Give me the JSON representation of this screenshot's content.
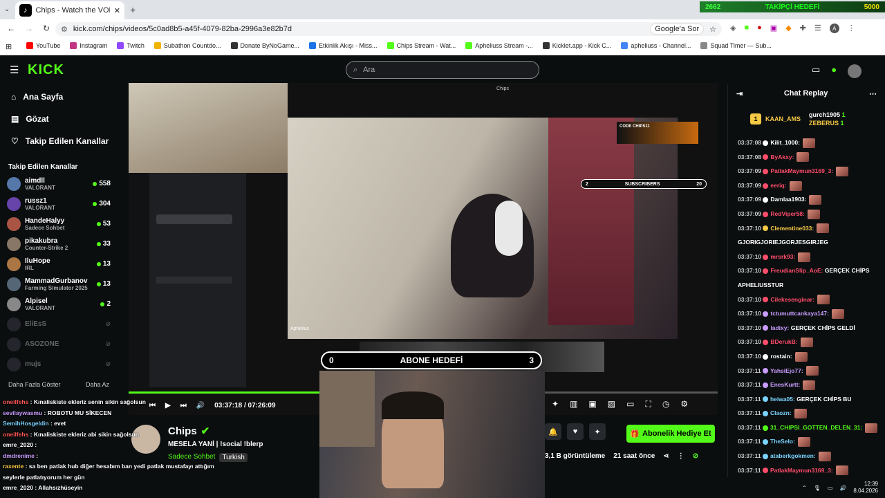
{
  "browser": {
    "tab_title": "Chips - Watch the VOD on Kick",
    "url": "kick.com/chips/videos/5c0ad8b5-a45f-4079-82ba-2996a3e82b7d",
    "google_btn": "Google'a Sor"
  },
  "goal_overlay": {
    "left": "2662",
    "mid": "TAKİPÇİ HEDEFİ",
    "right": "5000"
  },
  "bookmarks": [
    {
      "label": "YouTube",
      "color": "#ff0000"
    },
    {
      "label": "Instagram",
      "color": "#c13584"
    },
    {
      "label": "Twitch",
      "color": "#9146ff"
    },
    {
      "label": "Subathon Countdo...",
      "color": "#f0b400"
    },
    {
      "label": "Donate ByNoGame...",
      "color": "#333"
    },
    {
      "label": "Etkinlik Akışı - Miss...",
      "color": "#1a73e8"
    },
    {
      "label": "Chips Stream - Wat...",
      "color": "#53fc18"
    },
    {
      "label": "Apheliuss Stream -...",
      "color": "#53fc18"
    },
    {
      "label": "Kicklet.app - Kick C...",
      "color": "#333"
    },
    {
      "label": "apheliuss - Channel...",
      "color": "#4285f4"
    },
    {
      "label": "Squad Timer — Sub...",
      "color": "#888"
    }
  ],
  "kick": {
    "logo": "KICK",
    "search_placeholder": "Ara"
  },
  "nav": [
    {
      "label": "Ana Sayfa",
      "icon": "home-icon"
    },
    {
      "label": "Gözat",
      "icon": "browse-icon"
    },
    {
      "label": "Takip Edilen Kanallar",
      "icon": "heart-icon"
    }
  ],
  "followed_title": "Takip Edilen Kanallar",
  "channels": [
    {
      "name": "aimdll",
      "cat": "VALORANT",
      "viewers": "558",
      "color": "#5577aa"
    },
    {
      "name": "russz1",
      "cat": "VALORANT",
      "viewers": "304",
      "color": "#6644aa"
    },
    {
      "name": "HandeHalyy",
      "cat": "Sadece Sohbet",
      "viewers": "53",
      "color": "#aa5544"
    },
    {
      "name": "pikakubra",
      "cat": "Counter-Strike 2",
      "viewers": "33",
      "color": "#887766"
    },
    {
      "name": "IluHope",
      "cat": "IRL",
      "viewers": "13",
      "color": "#aa7744"
    },
    {
      "name": "MammadGurbanov",
      "cat": "Farming Simulator 2025",
      "viewers": "13",
      "color": "#556677"
    },
    {
      "name": "Alpisel",
      "cat": "VALORANT",
      "viewers": "2",
      "color": "#888"
    }
  ],
  "offline": [
    "EliEsS",
    "ASOZONE",
    "mujs"
  ],
  "sidebar_more": "Daha Fazla Göster",
  "sidebar_less": "Daha Az",
  "player": {
    "time": "03:37:18 / 07:26:09",
    "abone_left": "0",
    "abone_label": "ABONE HEDEFİ",
    "abone_right": "3",
    "subs_label": "SUBSCRIBERS",
    "subs_left": "2",
    "subs_right": "20",
    "window_title": "Chips",
    "cam_name": "Aphelius"
  },
  "channel": {
    "name": "Chips",
    "title": "MESELA YANİ | !social !blerp",
    "category": "Sadece Sohbet",
    "lang": "Turkish",
    "views": "3,1 B görüntüleme",
    "ago": "21 saat önce",
    "sub_button": "Abonelik Hediye Et"
  },
  "chat": {
    "title": "Chat Replay",
    "top_user": "KAAN_AMS",
    "top_rank": "1",
    "gift1": "gurch1905",
    "gift1_n": "1",
    "gift2": "ZEBERUS",
    "gift2_n": "1",
    "lines": [
      {
        "t": "03:37:08",
        "u": "Kilit_1000:",
        "c": "#fff",
        "m": ""
      },
      {
        "t": "03:37:08",
        "u": "ByAkxy:",
        "c": "#ff4d6a",
        "m": ""
      },
      {
        "t": "03:37:09",
        "u": "PatlakMaymun3169_3:",
        "c": "#ff4d6a",
        "m": ""
      },
      {
        "t": "03:37:09",
        "u": "eeriq:",
        "c": "#ff4d6a",
        "m": ""
      },
      {
        "t": "03:37:09",
        "u": "Damlaa1903:",
        "c": "#fff",
        "m": ""
      },
      {
        "t": "03:37:09",
        "u": "RedViper58:",
        "c": "#ff4d6a",
        "m": ""
      },
      {
        "t": "03:37:10",
        "u": "Clementine033:",
        "c": "#f6c945",
        "m": ""
      },
      {
        "t": "",
        "u": "",
        "c": "#fff",
        "m": "GJORIGJORIEJGORJESGIRJEG"
      },
      {
        "t": "03:37:10",
        "u": "mrsrk93:",
        "c": "#ff4d6a",
        "m": ""
      },
      {
        "t": "03:37:10",
        "u": "FreudianSlip_AoE:",
        "c": "#ff4d6a",
        "m": " GERÇEK CHİPS"
      },
      {
        "t": "",
        "u": "",
        "c": "#fff",
        "m": "APHELIUSSTUR"
      },
      {
        "t": "03:37:10",
        "u": "Cilekesenginar:",
        "c": "#ff4d6a",
        "m": ""
      },
      {
        "t": "03:37:10",
        "u": "tctumuttcankaya147:",
        "c": "#c99cff",
        "m": ""
      },
      {
        "t": "03:37:10",
        "u": "ladixy:",
        "c": "#c99cff",
        "m": " GERÇEK CHİPS GELDİ"
      },
      {
        "t": "03:37:10",
        "u": "BDerukB:",
        "c": "#ff4d6a",
        "m": ""
      },
      {
        "t": "03:37:10",
        "u": "rostain:",
        "c": "#fff",
        "m": ""
      },
      {
        "t": "03:37:11",
        "u": "YahsiEjo77:",
        "c": "#c99cff",
        "m": ""
      },
      {
        "t": "03:37:11",
        "u": "EnesKurtt:",
        "c": "#c99cff",
        "m": ""
      },
      {
        "t": "03:37:11",
        "u": "heiwa05:",
        "c": "#7ad3ff",
        "m": " GERÇEK CHİPS BU"
      },
      {
        "t": "03:37:11",
        "u": "Claozn:",
        "c": "#7ad3ff",
        "m": ""
      },
      {
        "t": "03:37:11",
        "u": "31_CHIPSI_GOTTEN_DELEN_31:",
        "c": "#53fc18",
        "m": ""
      },
      {
        "t": "03:37:11",
        "u": "TheSelo:",
        "c": "#7ad3ff",
        "m": ""
      },
      {
        "t": "03:37:11",
        "u": "ataberkgokmen:",
        "c": "#7ad3ff",
        "m": ""
      },
      {
        "t": "03:37:11",
        "u": "PatlakMaymun3169_3:",
        "c": "#ff4d6a",
        "m": ""
      }
    ]
  },
  "overlay_chat": [
    {
      "u": "oneilfehs",
      "c": "#ff5555",
      "m": " : Kınaliskiste ekleriz senin sikin sağolsun"
    },
    {
      "u": "sevilaywasmu",
      "c": "#c99cff",
      "m": " : ROBOTU MU SİKECEN"
    },
    {
      "u": "SemihHosgeldin",
      "c": "#7ad3ff",
      "m": " : evet"
    },
    {
      "u": "oneilfehs",
      "c": "#ff5555",
      "m": " : Kınaliskiste ekleriz abi sikin sağolsun"
    },
    {
      "u": "emre_2020",
      "c": "#fff",
      "m": " :"
    },
    {
      "u": "dmdrenime",
      "c": "#c99cff",
      "m": " :"
    },
    {
      "u": "raxente",
      "c": "#f6c945",
      "m": " : sa ben patlak hub diğer hesabım ban yedi patlak mustafayı attığım"
    },
    {
      "u": "",
      "c": "#fff",
      "m": "seylerle patlatıyorum her gün"
    },
    {
      "u": "emre_2020",
      "c": "#fff",
      "m": " : Allahsızhüseyin"
    }
  ],
  "taskbar": {
    "time": "12:39",
    "date": "8.04.2026"
  }
}
